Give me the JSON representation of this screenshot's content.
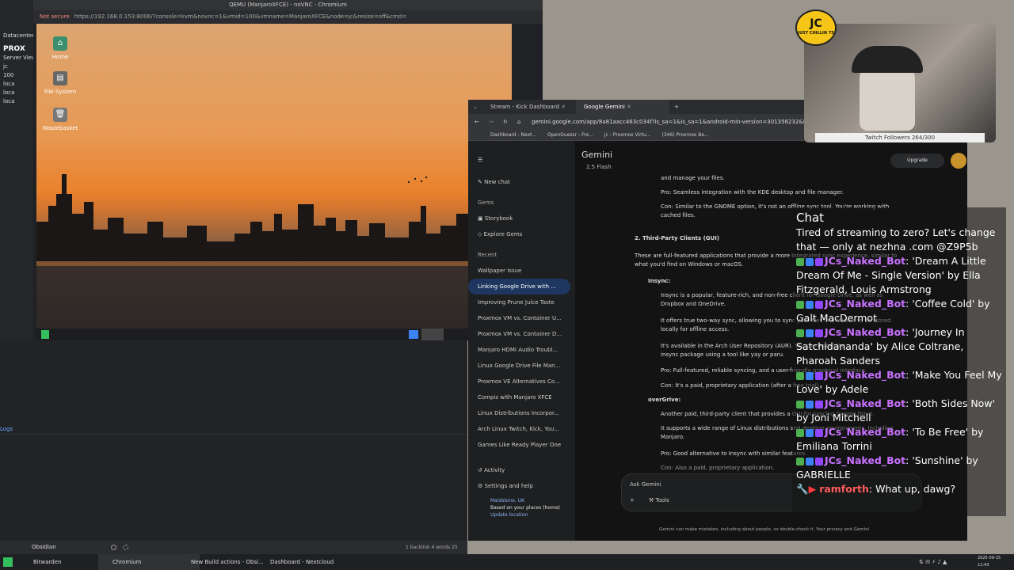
{
  "novnc": {
    "title": "QEMU (ManjaroXFCE) - noVNC - Chromium",
    "security": "Not secure",
    "url": "https://192.168.0.153:8006/?console=kvm&novnc=1&vmid=100&vmname=ManjaroXFCE&node=jc&resize=off&cmd="
  },
  "proxmox": {
    "logo": "PROX",
    "view": "Server View",
    "items": [
      "Datacenter",
      "jc",
      "100",
      "loca",
      "loca",
      "loca"
    ]
  },
  "desktop_icons": [
    "Home",
    "File System",
    "Wastebasket"
  ],
  "obsidian": {
    "label": "Obsidian",
    "status": "1 backlink   4 words   25 characters",
    "logs": "Logs"
  },
  "browser": {
    "tabs": [
      "Stream - Kick Dashboard",
      "Google Gemini"
    ],
    "url": "gemini.google.com/app/8a81aacc463c034f?is_sa=1&is_sa=1&android-min-version=301356232&io",
    "bookmarks": [
      "Dashboard - Next...",
      "OpenGuessr - Fre...",
      "jc - Proxmox Virtu...",
      "(346) Proxmox Be..."
    ]
  },
  "gemini": {
    "brand": "Gemini",
    "model": "2.5 Flash",
    "upgrade": "Upgrade",
    "new_chat": "New chat",
    "gems": "Gems",
    "storybook": "Storybook",
    "explore": "Explore Gems",
    "recent": "Recent",
    "recent_items": [
      "Wallpaper Issue",
      "Linking Google Drive with ...",
      "Improving Prune Juice Taste",
      "Proxmox VM vs. Container U...",
      "Proxmox VM vs. Container D...",
      "Manjaro HDMI Audio Troubl...",
      "Linux Google Drive File Man...",
      "Proxmox VE Alternatives Co...",
      "Compiz with Manjaro XFCE",
      "Linux Distributions Incorpor...",
      "Arch Linux Twitch, Kick, You...",
      "Games Like Ready Player One"
    ],
    "activity": "Activity",
    "settings": "Settings and help",
    "location": "Maidstone, UK",
    "location_sub": "Based on your places (home)",
    "update_location": "Update location",
    "lines": [
      "and manage your files.",
      "Pro: Seamless integration with the KDE desktop and file manager.",
      "Con: Similar to the GNOME option, it's not an offline sync tool. You're working with",
      "cached files.",
      "2. Third-Party Clients (GUI)",
      "These are full-featured applications that provide a more integrated sync experience, similar to",
      "what you'd find on Windows or macOS.",
      "Insync:",
      "Insync is a popular, feature-rich, and non-free client for Google Drive, as well as",
      "Dropbox and OneDrive.",
      "It offers true two-way sync, allowing you to sync your files and folders to be stored",
      "locally for offline access.",
      "It's available in the Arch User Repository (AUR). You can install the",
      "insync package using a tool like yay or paru.",
      "Pro: Full-featured, reliable syncing, and a user-friendly graphical interface.",
      "Con: It's a paid, proprietary application (after a free trial).",
      "overGrive:",
      "Another paid, third-party client that provides a GUI for syncing Google Drive.",
      "It supports a wide range of Linux distributions and desktop environments, including",
      "Manjaro.",
      "Pro: Good alternative to Insync with similar features.",
      "Con: Also a paid, proprietary application."
    ],
    "ask": "Ask Gemini",
    "tools": "Tools",
    "disclaimer": "Gemini can make mistakes, including about people, so double-check it. Your privacy and Gemini"
  },
  "webcam": {
    "followers": "Twitch Followers 264/300",
    "logo_top": "JC",
    "logo_sub": "JUST CHILLIN 75"
  },
  "chat": {
    "header": "Chat",
    "promo": "Tired of streaming to zero? Let's change that — only at nezhna .com @Z9P5b",
    "messages": [
      {
        "user": "JCs_Naked_Bot",
        "text": ": 'Dream A Little Dream Of Me - Single Version' by Ella Fitzgerald, Louis Armstrong"
      },
      {
        "user": "JCs_Naked_Bot",
        "text": ": 'Coffee Cold' by Galt MacDermot"
      },
      {
        "user": "JCs_Naked_Bot",
        "text": ": 'Journey In Satchidananda' by Alice Coltrane, Pharoah Sanders"
      },
      {
        "user": "JCs_Naked_Bot",
        "text": ": 'Make You Feel My Love' by Adele"
      },
      {
        "user": "JCs_Naked_Bot",
        "text": ": 'Both Sides Now' by Joni Mitchell"
      },
      {
        "user": "JCs_Naked_Bot",
        "text": ": 'To Be Free' by Emiliana Torrini"
      },
      {
        "user": "JCs_Naked_Bot",
        "text": ": 'Sunshine' by GABRIELLE"
      }
    ],
    "last": {
      "user": "ramforth",
      "text": ": What up, dawg?"
    }
  },
  "taskbar": {
    "items": [
      "Bitwarden",
      "Chromium",
      "New Build actions - Obsi...",
      "Dashboard - Nextcloud"
    ],
    "date": "2025-09-15",
    "time": "12:43"
  }
}
